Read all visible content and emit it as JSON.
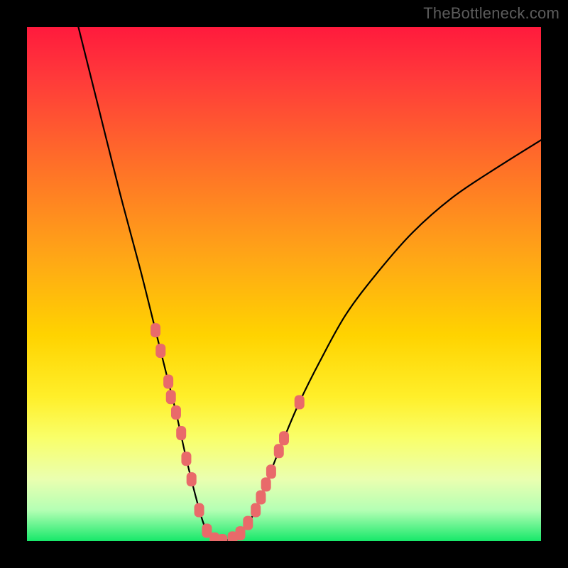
{
  "watermark": "TheBottleneck.com",
  "colors": {
    "frame": "#000000",
    "curve": "#000000",
    "marker_fill": "#e96a6a",
    "gradient_stops": [
      "#ff1a3d",
      "#ff3a3a",
      "#ff6a2a",
      "#ffa716",
      "#ffd300",
      "#ffef2a",
      "#f9ff6a",
      "#eaffb0",
      "#b4ffb4",
      "#17e86a"
    ]
  },
  "chart_data": {
    "type": "line",
    "title": "",
    "xlabel": "",
    "ylabel": "",
    "xlim": [
      0,
      100
    ],
    "ylim": [
      0,
      100
    ],
    "series": [
      {
        "name": "bottleneck-curve",
        "x": [
          10,
          14,
          18,
          22,
          25,
          27,
          29,
          31,
          33,
          34.5,
          36,
          37,
          38,
          40,
          42,
          44.5,
          46,
          48,
          50,
          53,
          57,
          62,
          68,
          75,
          83,
          92,
          100
        ],
        "values": [
          100,
          84,
          68,
          53,
          41,
          33,
          25,
          16,
          8,
          3,
          0.5,
          0,
          0,
          0.5,
          2,
          6,
          10,
          15,
          20,
          27,
          35,
          44,
          52,
          60,
          67,
          73,
          78
        ]
      }
    ],
    "markers": [
      {
        "x": 25,
        "y": 41
      },
      {
        "x": 26,
        "y": 37
      },
      {
        "x": 27.5,
        "y": 31
      },
      {
        "x": 28,
        "y": 28
      },
      {
        "x": 29,
        "y": 25
      },
      {
        "x": 30,
        "y": 21
      },
      {
        "x": 31,
        "y": 16
      },
      {
        "x": 32,
        "y": 12
      },
      {
        "x": 33.5,
        "y": 6
      },
      {
        "x": 35,
        "y": 2
      },
      {
        "x": 36.5,
        "y": 0.3
      },
      {
        "x": 38,
        "y": 0
      },
      {
        "x": 40,
        "y": 0.5
      },
      {
        "x": 41.5,
        "y": 1.5
      },
      {
        "x": 43,
        "y": 3.5
      },
      {
        "x": 44.5,
        "y": 6
      },
      {
        "x": 45.5,
        "y": 8.5
      },
      {
        "x": 46.5,
        "y": 11
      },
      {
        "x": 47.5,
        "y": 13.5
      },
      {
        "x": 49,
        "y": 17.5
      },
      {
        "x": 50,
        "y": 20
      },
      {
        "x": 53,
        "y": 27
      }
    ]
  }
}
